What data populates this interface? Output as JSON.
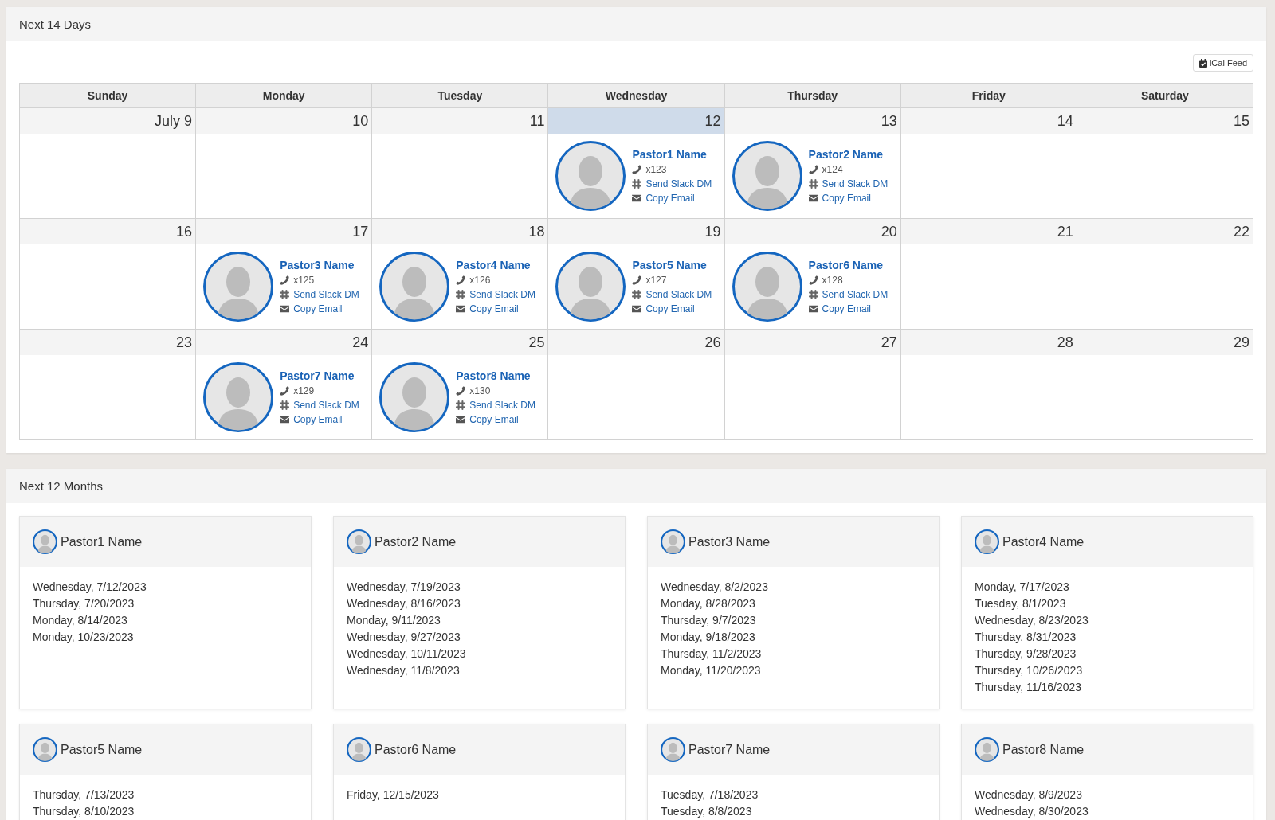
{
  "next_14_days": {
    "title": "Next 14 Days",
    "ical_button": "iCal Feed",
    "weekdays": [
      "Sunday",
      "Monday",
      "Tuesday",
      "Wednesday",
      "Thursday",
      "Friday",
      "Saturday"
    ],
    "weeks": [
      [
        {
          "day": "July 9",
          "today": false
        },
        {
          "day": "10",
          "today": false
        },
        {
          "day": "11",
          "today": false
        },
        {
          "day": "12",
          "today": true,
          "pastor": {
            "name": "Pastor1 Name",
            "extension": "x123",
            "slack_link": "Send Slack DM",
            "email_link": "Copy Email"
          }
        },
        {
          "day": "13",
          "today": false,
          "pastor": {
            "name": "Pastor2 Name",
            "extension": "x124",
            "slack_link": "Send Slack DM",
            "email_link": "Copy Email"
          }
        },
        {
          "day": "14",
          "today": false
        },
        {
          "day": "15",
          "today": false
        }
      ],
      [
        {
          "day": "16",
          "today": false
        },
        {
          "day": "17",
          "today": false,
          "pastor": {
            "name": "Pastor3 Name",
            "extension": "x125",
            "slack_link": "Send Slack DM",
            "email_link": "Copy Email"
          }
        },
        {
          "day": "18",
          "today": false,
          "pastor": {
            "name": "Pastor4 Name",
            "extension": "x126",
            "slack_link": "Send Slack DM",
            "email_link": "Copy Email"
          }
        },
        {
          "day": "19",
          "today": false,
          "pastor": {
            "name": "Pastor5 Name",
            "extension": "x127",
            "slack_link": "Send Slack DM",
            "email_link": "Copy Email"
          }
        },
        {
          "day": "20",
          "today": false,
          "pastor": {
            "name": "Pastor6 Name",
            "extension": "x128",
            "slack_link": "Send Slack DM",
            "email_link": "Copy Email"
          }
        },
        {
          "day": "21",
          "today": false
        },
        {
          "day": "22",
          "today": false
        }
      ],
      [
        {
          "day": "23",
          "today": false
        },
        {
          "day": "24",
          "today": false,
          "pastor": {
            "name": "Pastor7 Name",
            "extension": "x129",
            "slack_link": "Send Slack DM",
            "email_link": "Copy Email"
          }
        },
        {
          "day": "25",
          "today": false,
          "pastor": {
            "name": "Pastor8 Name",
            "extension": "x130",
            "slack_link": "Send Slack DM",
            "email_link": "Copy Email"
          }
        },
        {
          "day": "26",
          "today": false
        },
        {
          "day": "27",
          "today": false
        },
        {
          "day": "28",
          "today": false
        },
        {
          "day": "29",
          "today": false
        }
      ]
    ]
  },
  "next_12_months": {
    "title": "Next 12 Months",
    "pastors": [
      {
        "name": "Pastor1 Name",
        "dates": [
          "Wednesday, 7/12/2023",
          "Thursday, 7/20/2023",
          "Monday, 8/14/2023",
          "Monday, 10/23/2023"
        ]
      },
      {
        "name": "Pastor2 Name",
        "dates": [
          "Wednesday, 7/19/2023",
          "Wednesday, 8/16/2023",
          "Monday, 9/11/2023",
          "Wednesday, 9/27/2023",
          "Wednesday, 10/11/2023",
          "Wednesday, 11/8/2023"
        ]
      },
      {
        "name": "Pastor3 Name",
        "dates": [
          "Wednesday, 8/2/2023",
          "Monday, 8/28/2023",
          "Thursday, 9/7/2023",
          "Monday, 9/18/2023",
          "Thursday, 11/2/2023",
          "Monday, 11/20/2023"
        ]
      },
      {
        "name": "Pastor4 Name",
        "dates": [
          "Monday, 7/17/2023",
          "Tuesday, 8/1/2023",
          "Wednesday, 8/23/2023",
          "Thursday, 8/31/2023",
          "Thursday, 9/28/2023",
          "Thursday, 10/26/2023",
          "Thursday, 11/16/2023"
        ]
      },
      {
        "name": "Pastor5 Name",
        "dates": [
          "Thursday, 7/13/2023",
          "Thursday, 8/10/2023"
        ]
      },
      {
        "name": "Pastor6 Name",
        "dates": [
          "Friday, 12/15/2023"
        ]
      },
      {
        "name": "Pastor7 Name",
        "dates": [
          "Tuesday, 7/18/2023",
          "Tuesday, 8/8/2023"
        ]
      },
      {
        "name": "Pastor8 Name",
        "dates": [
          "Wednesday, 8/9/2023",
          "Wednesday, 8/30/2023"
        ]
      }
    ]
  }
}
